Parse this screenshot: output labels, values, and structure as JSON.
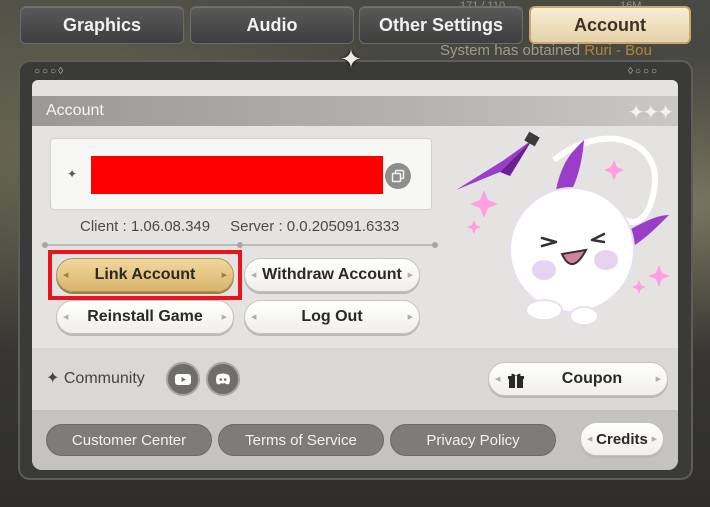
{
  "background": {
    "system_message_parts": [
      "System",
      "has obtained",
      "Ruri - Bou"
    ],
    "stats_left": "171 / 110",
    "stats_right": "16M"
  },
  "tabs": [
    {
      "label": "Graphics",
      "active": false
    },
    {
      "label": "Audio",
      "active": false
    },
    {
      "label": "Other Settings",
      "active": false
    },
    {
      "label": "Account",
      "active": true
    }
  ],
  "account": {
    "section_title": "Account",
    "id_redacted": true,
    "client_version": "Client : 1.06.08.349",
    "server_version": "Server : 0.0.205091.6333",
    "buttons": {
      "link": "Link Account",
      "withdraw": "Withdraw Account",
      "reinstall": "Reinstall Game",
      "logout": "Log Out"
    }
  },
  "community": {
    "label": "Community",
    "social_icons": [
      "youtube-icon",
      "discord-icon"
    ],
    "coupon_label": "Coupon"
  },
  "footer": {
    "customer_center": "Customer Center",
    "terms": "Terms of Service",
    "privacy": "Privacy Policy",
    "credits": "Credits"
  },
  "colors": {
    "active_tab": "#e6d2aa",
    "link_button": "#d9b56c",
    "highlight": "#e8141e",
    "redaction": "#ff0000"
  }
}
